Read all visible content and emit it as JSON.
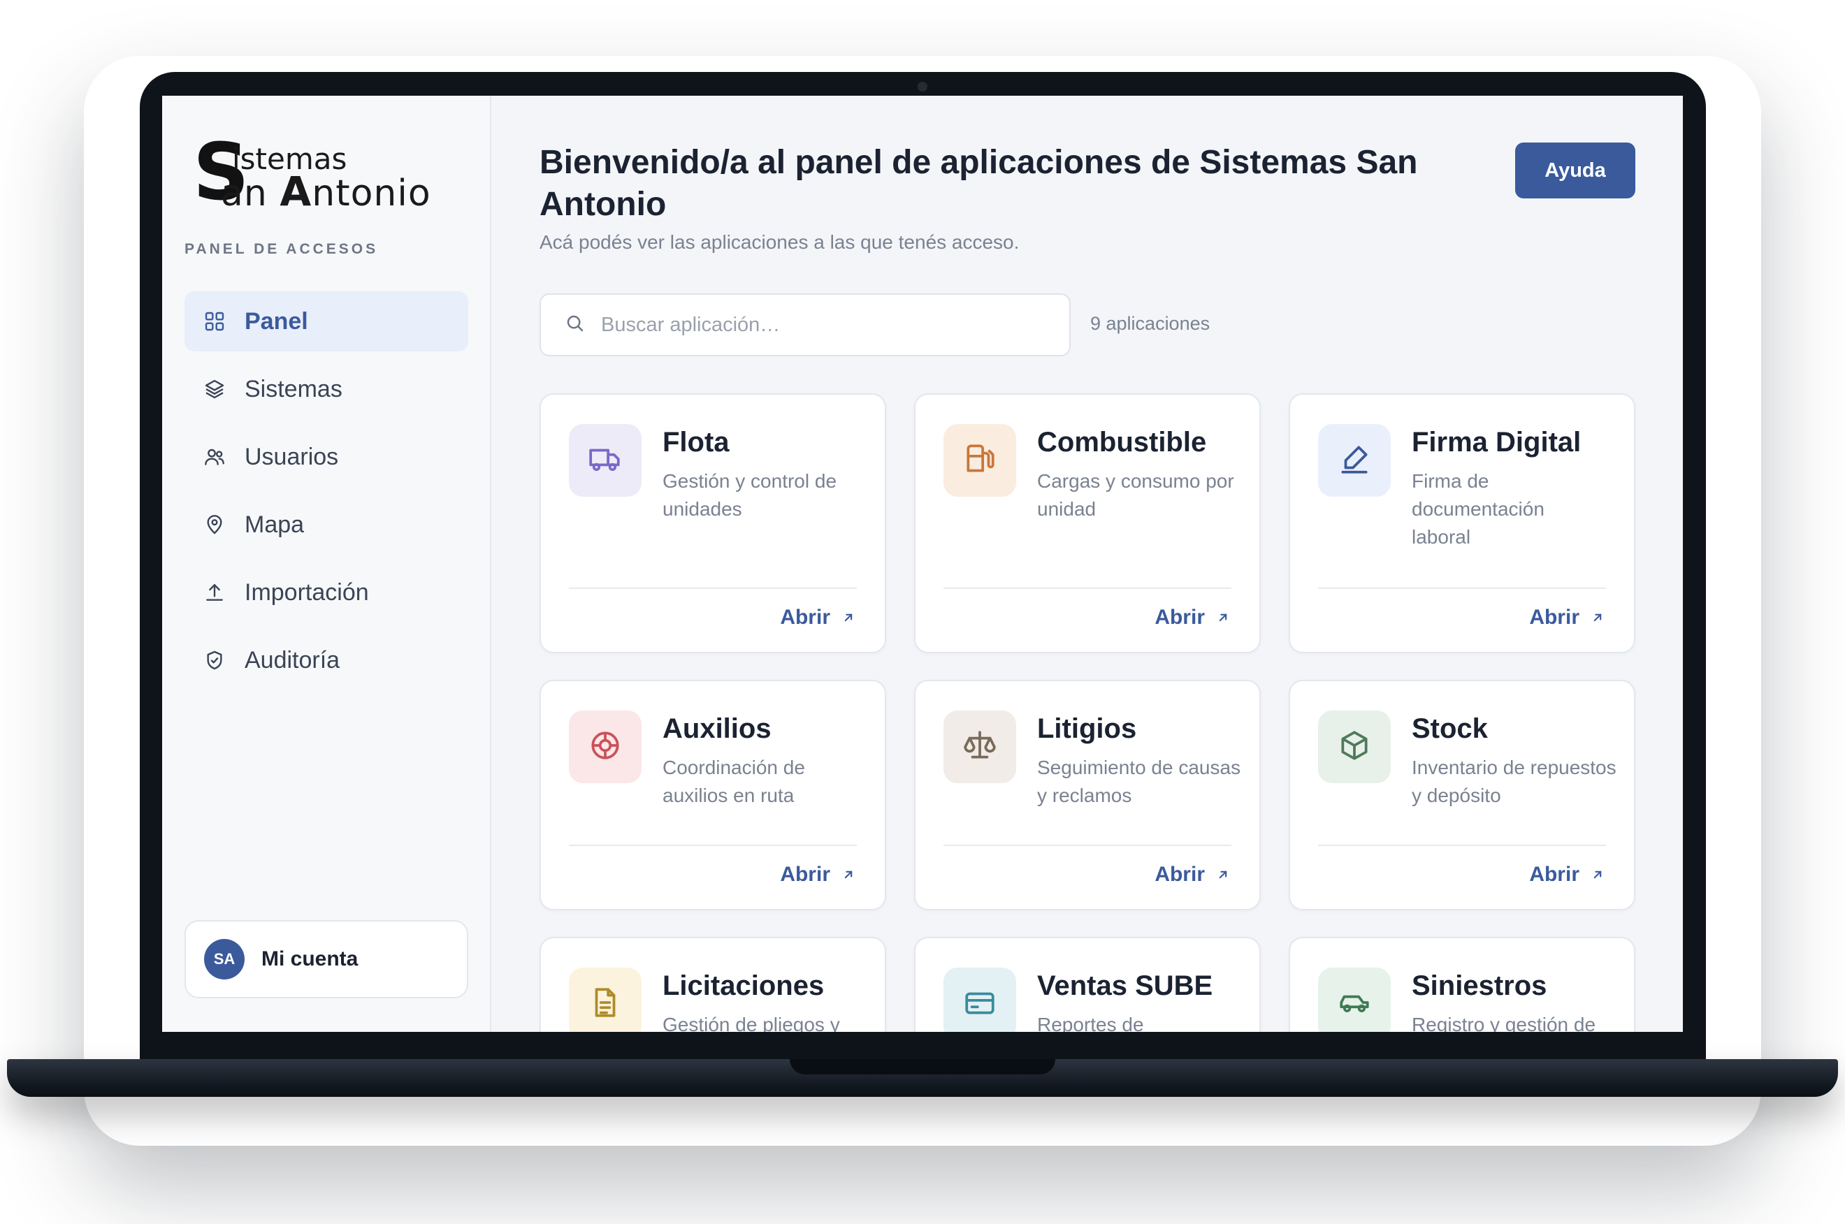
{
  "brand": {
    "logo_line1": "istemas",
    "logo_line2": "an ntonio",
    "logo_big_s": "S",
    "logo_big_a": "A",
    "section_label": "PANEL DE ACCESOS"
  },
  "sidebar": {
    "items": [
      {
        "label": "Panel",
        "icon": "grid-icon",
        "active": true
      },
      {
        "label": "Sistemas",
        "icon": "layers-icon",
        "active": false
      },
      {
        "label": "Usuarios",
        "icon": "users-icon",
        "active": false
      },
      {
        "label": "Mapa",
        "icon": "map-pin-icon",
        "active": false
      },
      {
        "label": "Importación",
        "icon": "upload-icon",
        "active": false
      },
      {
        "label": "Auditoría",
        "icon": "shield-check-icon",
        "active": false
      }
    ],
    "account": {
      "initials": "SA",
      "label": "Mi cuenta"
    }
  },
  "header": {
    "title": "Bienvenido/a al panel de aplicaciones de Sistemas San Antonio",
    "subtitle": "Acá podés ver las aplicaciones a las que tenés acceso.",
    "help_label": "Ayuda"
  },
  "search": {
    "placeholder": "Buscar aplicación…",
    "value": "",
    "count_label": "9 aplicaciones"
  },
  "open_label": "Abrir",
  "apps": [
    {
      "title": "Flota",
      "desc": "Gestión y control de unidades",
      "icon": "truck-icon",
      "color": "#7a68c9",
      "bg": "#eeebf8"
    },
    {
      "title": "Combustible",
      "desc": "Cargas y consumo por unidad",
      "icon": "fuel-icon",
      "color": "#c9773a",
      "bg": "#fbece0"
    },
    {
      "title": "Firma Digital",
      "desc": "Firma de documentación laboral",
      "icon": "pen-icon",
      "color": "#3a5a9c",
      "bg": "#eaf0fb"
    },
    {
      "title": "Auxilios",
      "desc": "Coordinación de auxilios en ruta",
      "icon": "lifebuoy-icon",
      "color": "#c9525a",
      "bg": "#fbe7e8"
    },
    {
      "title": "Litigios",
      "desc": "Seguimiento de causas y reclamos",
      "icon": "scale-icon",
      "color": "#7a6a5a",
      "bg": "#f1ece7"
    },
    {
      "title": "Stock",
      "desc": "Inventario de repuestos y depósito",
      "icon": "box-icon",
      "color": "#4e7a5a",
      "bg": "#e8f0ea"
    },
    {
      "title": "Licitaciones",
      "desc": "Gestión de pliegos y",
      "icon": "document-icon",
      "color": "#b08a2a",
      "bg": "#fbf3dd"
    },
    {
      "title": "Ventas SUBE",
      "desc": "Reportes de",
      "icon": "card-icon",
      "color": "#3a8a9c",
      "bg": "#e3f1f4"
    },
    {
      "title": "Siniestros",
      "desc": "Registro y gestión de",
      "icon": "car-icon",
      "color": "#3f7a55",
      "bg": "#e6f2ea"
    }
  ]
}
